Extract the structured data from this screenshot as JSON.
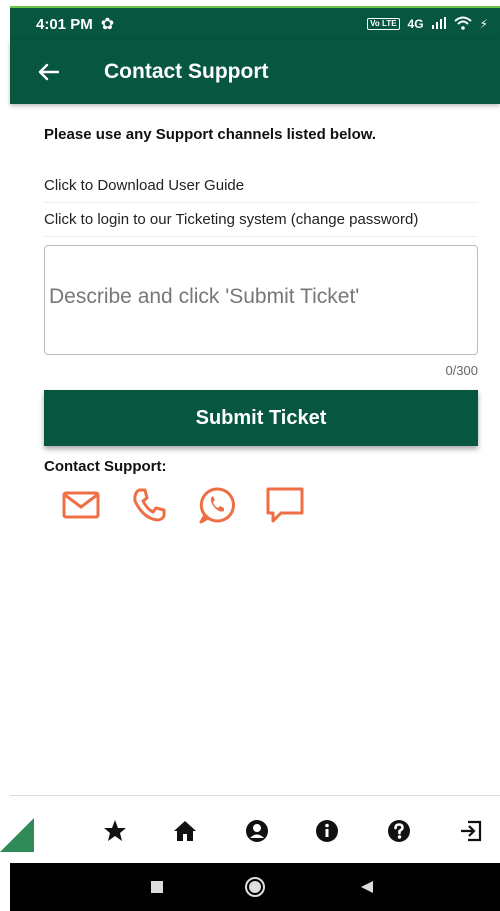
{
  "status_bar": {
    "time": "4:01 PM",
    "network": "4G",
    "volte": "Vo LTE"
  },
  "app_bar": {
    "title": "Contact Support",
    "back_icon": "arrow-left-icon"
  },
  "content": {
    "intro": "Please use any Support channels listed below.",
    "links": [
      {
        "label": "Click to Download User Guide"
      },
      {
        "label": "Click to login to our Ticketing system (change password)"
      }
    ],
    "ticket": {
      "placeholder": "Describe and click 'Submit Ticket'",
      "counter": "0/300"
    },
    "submit_label": "Submit Ticket",
    "contact_label": "Contact Support:",
    "contact_icons": [
      "mail-icon",
      "phone-icon",
      "whatsapp-icon",
      "chat-icon"
    ]
  },
  "bottom_nav": [
    "star-icon",
    "home-icon",
    "profile-icon",
    "info-icon",
    "help-icon",
    "logout-icon"
  ],
  "colors": {
    "primary": "#07563f",
    "accent": "#ef6f45"
  }
}
